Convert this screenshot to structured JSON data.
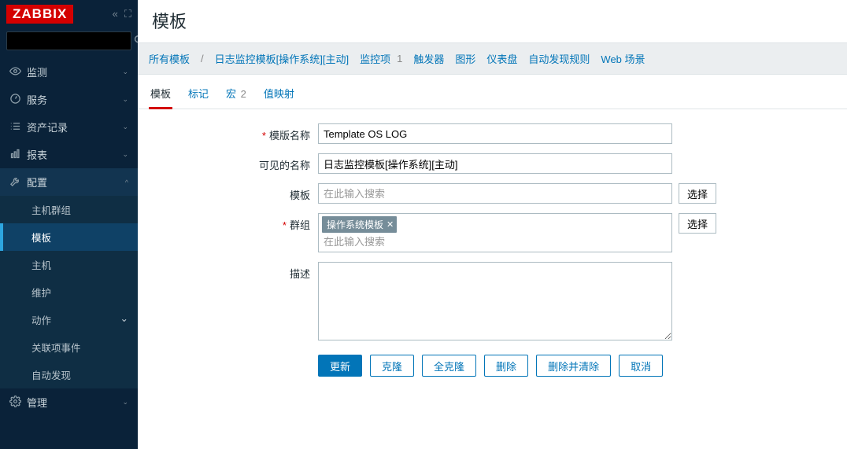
{
  "logo": "ZABBIX",
  "sidebar": {
    "search_placeholder": "",
    "items": [
      {
        "icon": "eye",
        "label": "监测",
        "chev": "⌄"
      },
      {
        "icon": "gauge",
        "label": "服务",
        "chev": "⌄"
      },
      {
        "icon": "list",
        "label": "资产记录",
        "chev": "⌄"
      },
      {
        "icon": "chart",
        "label": "报表",
        "chev": "⌄"
      },
      {
        "icon": "wrench",
        "label": "配置",
        "chev": "^",
        "expanded": true
      },
      {
        "icon": "gear",
        "label": "管理",
        "chev": "⌄"
      }
    ],
    "config_sub": [
      {
        "label": "主机群组"
      },
      {
        "label": "模板",
        "active": true
      },
      {
        "label": "主机"
      },
      {
        "label": "维护"
      },
      {
        "label": "动作",
        "chev": "⌄"
      },
      {
        "label": "关联项事件"
      },
      {
        "label": "自动发现"
      }
    ]
  },
  "page": {
    "title": "模板"
  },
  "breadcrumb": {
    "all": "所有模板",
    "current": "日志监控模板[操作系统][主动]",
    "links": [
      {
        "label": "监控项",
        "count": "1"
      },
      {
        "label": "触发器"
      },
      {
        "label": "图形"
      },
      {
        "label": "仪表盘"
      },
      {
        "label": "自动发现规则"
      },
      {
        "label": "Web 场景"
      }
    ]
  },
  "tabs": [
    {
      "label": "模板",
      "active": true
    },
    {
      "label": "标记"
    },
    {
      "label": "宏",
      "count": "2"
    },
    {
      "label": "值映射"
    }
  ],
  "form": {
    "labels": {
      "name": "模版名称",
      "visible_name": "可见的名称",
      "templates": "模板",
      "groups": "群组",
      "description": "描述"
    },
    "name_value": "Template OS LOG",
    "visible_name_value": "日志监控模板[操作系统][主动]",
    "templates_placeholder": "在此输入搜索",
    "groups_tag": "操作系统模板",
    "groups_placeholder": "在此输入搜索",
    "select_btn": "选择"
  },
  "actions": {
    "update": "更新",
    "clone": "克隆",
    "full_clone": "全克隆",
    "delete": "删除",
    "delete_clear": "删除并清除",
    "cancel": "取消"
  }
}
